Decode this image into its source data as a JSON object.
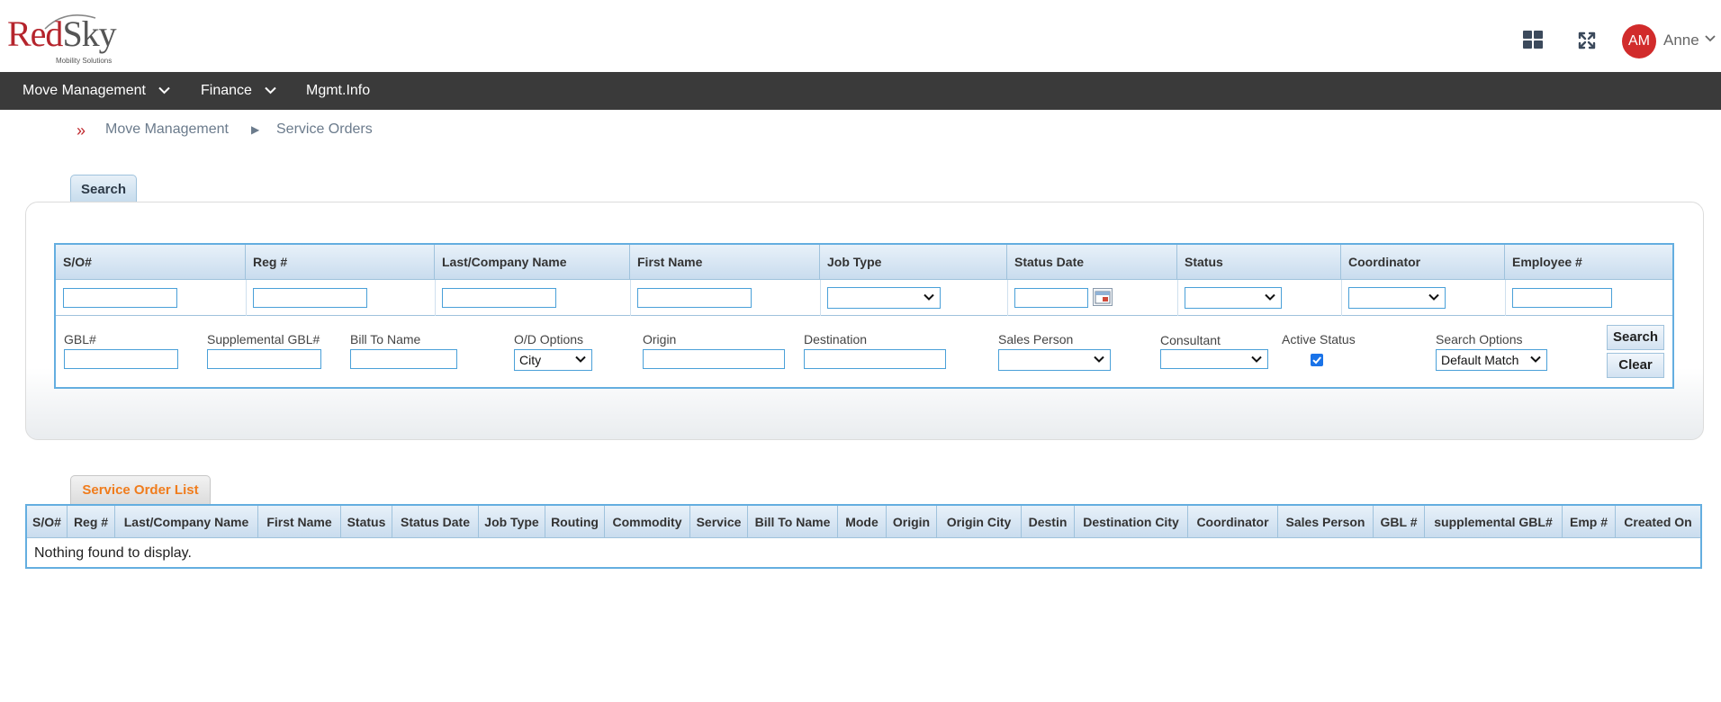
{
  "brand": {
    "name_part1": "Red",
    "name_part2": "Sky",
    "tagline": "Mobility Solutions"
  },
  "user": {
    "initials": "AM",
    "name": "Anne"
  },
  "header_icons": [
    "apps-grid-icon",
    "fullscreen-icon",
    "chevron-down-icon"
  ],
  "nav": {
    "items": [
      {
        "label": "Move Management",
        "dropdown": true
      },
      {
        "label": "Finance",
        "dropdown": true
      },
      {
        "label": "Mgmt.Info",
        "dropdown": false
      }
    ]
  },
  "breadcrumb": {
    "arrows": "»",
    "section": "Move Management",
    "separator": "▶",
    "page": "Service Orders"
  },
  "search": {
    "tab_label": "Search",
    "columns": [
      "S/O#",
      "Reg #",
      "Last/Company Name",
      "First Name",
      "Job Type",
      "Status Date",
      "Status",
      "Coordinator",
      "Employee #"
    ],
    "fields": {
      "gbl": "GBL#",
      "supplemental_gbl": "Supplemental GBL#",
      "bill_to_name": "Bill To Name",
      "od_options": "O/D Options",
      "od_options_value": "City",
      "origin": "Origin",
      "destination": "Destination",
      "sales_person": "Sales Person",
      "consultant": "Consultant",
      "active_status": "Active Status",
      "active_status_checked": true,
      "search_options": "Search Options",
      "search_options_value": "Default Match"
    },
    "buttons": {
      "search": "Search",
      "clear": "Clear"
    }
  },
  "list": {
    "tab_label": "Service Order List",
    "columns": [
      "S/O#",
      "Reg #",
      "Last/Company Name",
      "First Name",
      "Status",
      "Status Date",
      "Job Type",
      "Routing",
      "Commodity",
      "Service",
      "Bill To Name",
      "Mode",
      "Origin",
      "Origin City",
      "Destin",
      "Destination City",
      "Coordinator",
      "Sales Person",
      "GBL #",
      "supplemental GBL#",
      "Emp #",
      "Created On"
    ],
    "empty_message": "Nothing found to display."
  },
  "colors": {
    "brand_red": "#b5242c",
    "nav_bg": "#3a3a3a",
    "grid_border": "#64aee0",
    "list_tab_text": "#f07c1c",
    "avatar_bg": "#d12b2b"
  }
}
